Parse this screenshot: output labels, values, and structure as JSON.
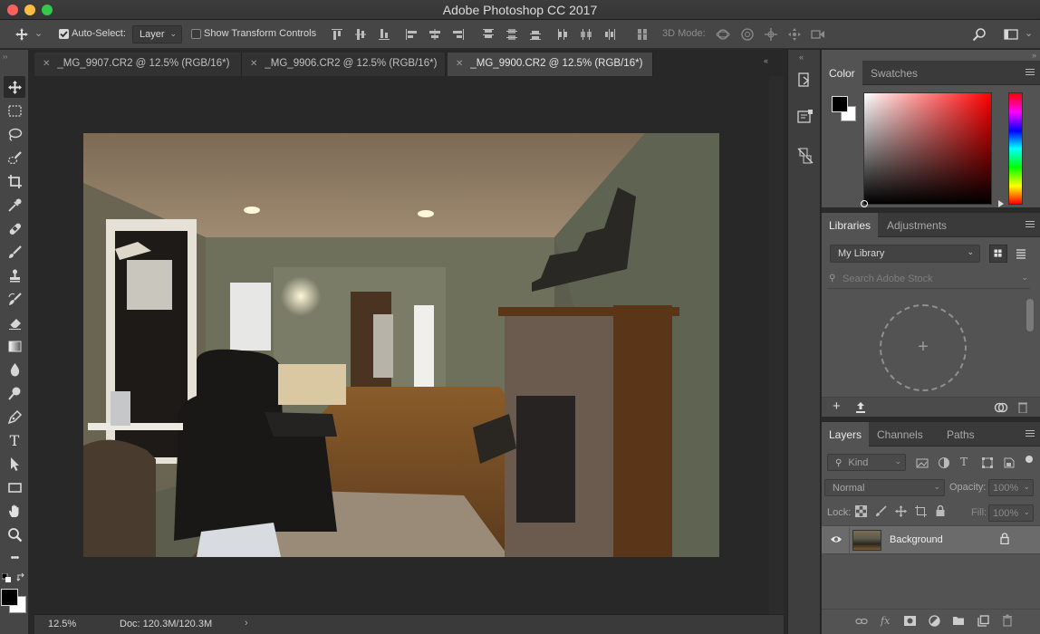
{
  "window": {
    "title": "Adobe Photoshop CC 2017"
  },
  "options_bar": {
    "auto_select_label": "Auto-Select:",
    "auto_select_checked": true,
    "auto_select_target": "Layer",
    "show_transform_label": "Show Transform Controls",
    "show_transform_checked": false,
    "mode_3d_label": "3D Mode:"
  },
  "tabs": [
    {
      "label": "_MG_9907.CR2 @ 12.5% (RGB/16*)",
      "active": false
    },
    {
      "label": "_MG_9906.CR2 @ 12.5% (RGB/16*)",
      "active": false
    },
    {
      "label": "_MG_9900.CR2 @ 12.5% (RGB/16*)",
      "active": true
    }
  ],
  "tools": [
    "move-tool-icon",
    "rectangular-marquee-icon",
    "lasso-icon",
    "quick-selection-icon",
    "crop-icon",
    "eyedropper-icon",
    "healing-brush-icon",
    "brush-icon",
    "clone-stamp-icon",
    "history-brush-icon",
    "eraser-icon",
    "gradient-icon",
    "blur-icon",
    "dodge-icon",
    "pen-icon",
    "type-icon",
    "path-selection-icon",
    "rectangle-icon",
    "hand-icon",
    "zoom-icon",
    "more-tools-icon"
  ],
  "type_tool_glyph": "T",
  "more_tools_glyph": "•••",
  "status_bar": {
    "zoom": "12.5%",
    "doc_size": "Doc: 120.3M/120.3M"
  },
  "color_panel": {
    "tabs": [
      "Color",
      "Swatches"
    ],
    "active_tab": "Color",
    "foreground": "#000000",
    "background": "#ffffff",
    "hue_color": "#ff0000"
  },
  "libraries_panel": {
    "tabs": [
      "Libraries",
      "Adjustments"
    ],
    "active_tab": "Libraries",
    "library": "My Library",
    "search_placeholder": "Search Adobe Stock"
  },
  "layers_panel": {
    "tabs": [
      "Layers",
      "Channels",
      "Paths"
    ],
    "active_tab": "Layers",
    "filter_kind": "Kind",
    "blend_mode": "Normal",
    "opacity_label": "Opacity:",
    "opacity_value": "100%",
    "lock_label": "Lock:",
    "fill_label": "Fill:",
    "fill_value": "100%",
    "layers": [
      {
        "name": "Background",
        "visible": true,
        "locked": true
      }
    ]
  }
}
